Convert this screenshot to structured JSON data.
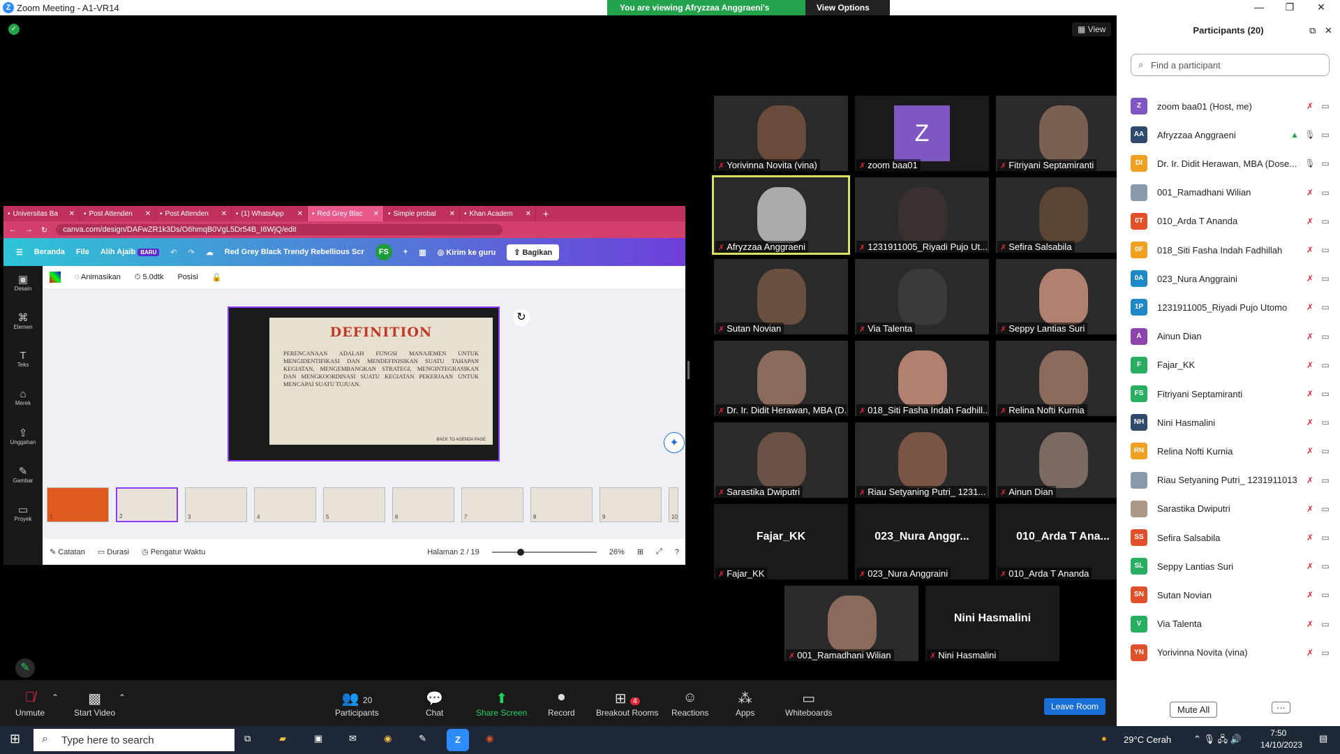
{
  "window": {
    "title": "Zoom Meeting - A1-VR14",
    "banner": "You are viewing Afryzzaa Anggraeni's screen",
    "view_options": "View Options",
    "view": "View"
  },
  "browser": {
    "tabs": [
      "Universitas Ba",
      "Post Attenden",
      "Post Attenden",
      "(1) WhatsApp",
      "Red Grey Blac",
      "Simple probal",
      "Khan Academ"
    ],
    "url": "canva.com/design/DAFwZR1k3Ds/O6hmqB0VgL5Dr54B_I6WjQ/edit"
  },
  "canva": {
    "home": "Beranda",
    "file": "File",
    "user": "Alih Ajaib",
    "badge": "BARU",
    "doc_title": "Red Grey Black Trendy Rebellious Scr...",
    "send": "Kirim ke guru",
    "share": "Bagikan",
    "left": [
      "Desain",
      "Elemen",
      "Teks",
      "Merek",
      "Unggahan",
      "Gambar",
      "Proyek"
    ],
    "tool": {
      "anim": "Animasikan",
      "dur": "5.0dtk",
      "pos": "Posisi"
    },
    "slide_title": "DEFINITION",
    "slide_body": "PERENCANAAN ADALAH FUNGSI MANAJEMEN UNTUK MENGIDENTIFIKASI DAN MENDEFINISIKAN SUATU TAHAPAN KEGIATAN, MENGEMBANGKAN STRATEGI, MENGINTEGRASIKAN DAN MENGKOORDINASI SUATU KEGIATAN PEKERJAAN UNTUK MENCAPAI SUATU TUJUAN.",
    "slide_footer": "BACK TO AGENDA PAGE",
    "thumbs": [
      "1",
      "2",
      "3",
      "4",
      "5",
      "6",
      "7",
      "8",
      "9",
      "10"
    ],
    "notes": "Catatan",
    "duration": "Durasi",
    "timer": "Pengatur Waktu",
    "page": "Halaman 2 / 19",
    "zoom": "26%"
  },
  "tiles": [
    {
      "name": "Yorivinna Novita (vina)",
      "type": "video"
    },
    {
      "name": "zoom baa01",
      "type": "avatar",
      "letter": "Z"
    },
    {
      "name": "Fitriyani Septamiranti",
      "type": "video"
    },
    {
      "name": "Afryzzaa Anggraeni",
      "type": "video"
    },
    {
      "name": "1231911005_Riyadi Pujo Ut...",
      "type": "video"
    },
    {
      "name": "Sefira Salsabila",
      "type": "video"
    },
    {
      "name": "Sutan Novian",
      "type": "video"
    },
    {
      "name": "Via Talenta",
      "type": "video"
    },
    {
      "name": "Seppy Lantias Suri",
      "type": "video"
    },
    {
      "name": "Dr. Ir. Didit Herawan, MBA (D...",
      "type": "video"
    },
    {
      "name": "018_Siti Fasha Indah Fadhill...",
      "type": "video"
    },
    {
      "name": "Relina Nofti Kurnia",
      "type": "video"
    },
    {
      "name": "Sarastika Dwiputri",
      "type": "video"
    },
    {
      "name": "Riau Setyaning Putri_ 1231...",
      "type": "video"
    },
    {
      "name": "Ainun Dian",
      "type": "video"
    },
    {
      "name": "Fajar_KK",
      "type": "text",
      "big": "Fajar_KK"
    },
    {
      "name": "023_Nura Anggraini",
      "type": "text",
      "big": "023_Nura Anggr..."
    },
    {
      "name": "010_Arda T Ananda",
      "type": "text",
      "big": "010_Arda T Ana..."
    },
    {
      "name": "001_Ramadhani Wilian",
      "type": "video"
    },
    {
      "name": "Nini Hasmalini",
      "type": "text",
      "big": "Nini Hasmalini"
    }
  ],
  "toolbar": {
    "unmute": "Unmute",
    "video": "Start Video",
    "participants": "Participants",
    "pcount": "20",
    "chat": "Chat",
    "share": "Share Screen",
    "record": "Record",
    "breakout": "Breakout Rooms",
    "breakout_badge": "4",
    "reactions": "Reactions",
    "apps": "Apps",
    "whiteboards": "Whiteboards",
    "leave": "Leave Room"
  },
  "panel": {
    "title": "Participants (20)",
    "search_placeholder": "Find a participant",
    "mute_all": "Mute All",
    "more": "···",
    "participants": [
      {
        "initials": "Z",
        "name": "zoom baa01 (Host, me)",
        "color": "#7e57c2"
      },
      {
        "initials": "AA",
        "name": "Afryzzaa Anggraeni",
        "color": "#2f4a6d"
      },
      {
        "initials": "DI",
        "name": "Dr. Ir. Didit Herawan, MBA (Dose...",
        "color": "#f0a020"
      },
      {
        "initials": "",
        "name": "001_Ramadhani Wilian",
        "color": "#8899aa"
      },
      {
        "initials": "0T",
        "name": "010_Arda T Ananda",
        "color": "#e0502a"
      },
      {
        "initials": "0F",
        "name": "018_Siti Fasha Indah Fadhillah",
        "color": "#f0a020"
      },
      {
        "initials": "0A",
        "name": "023_Nura Anggraini",
        "color": "#1e88c8"
      },
      {
        "initials": "1P",
        "name": "1231911005_Riyadi Pujo Utomo",
        "color": "#1e88c8"
      },
      {
        "initials": "A",
        "name": "Ainun Dian",
        "color": "#8e44ad"
      },
      {
        "initials": "F",
        "name": "Fajar_KK",
        "color": "#27ae60"
      },
      {
        "initials": "FS",
        "name": "Fitriyani Septamiranti",
        "color": "#27ae60"
      },
      {
        "initials": "NH",
        "name": "Nini Hasmalini",
        "color": "#2f4a6d"
      },
      {
        "initials": "RN",
        "name": "Relina Nofti Kurnia",
        "color": "#f0a020"
      },
      {
        "initials": "",
        "name": "Riau Setyaning Putri_ 1231911013",
        "color": "#8899aa"
      },
      {
        "initials": "",
        "name": "Sarastika Dwiputri",
        "color": "#aa9988"
      },
      {
        "initials": "SS",
        "name": "Sefira Salsabila",
        "color": "#e0502a"
      },
      {
        "initials": "SL",
        "name": "Seppy Lantias Suri",
        "color": "#27ae60"
      },
      {
        "initials": "SN",
        "name": "Sutan Novian",
        "color": "#e0502a"
      },
      {
        "initials": "V",
        "name": "Via Talenta",
        "color": "#27ae60"
      },
      {
        "initials": "YN",
        "name": "Yorivinna Novita (vina)",
        "color": "#e0502a"
      }
    ]
  },
  "taskbar": {
    "search": "Type here to search",
    "weather": "29°C Cerah",
    "time": "7:50",
    "date": "14/10/2023"
  }
}
